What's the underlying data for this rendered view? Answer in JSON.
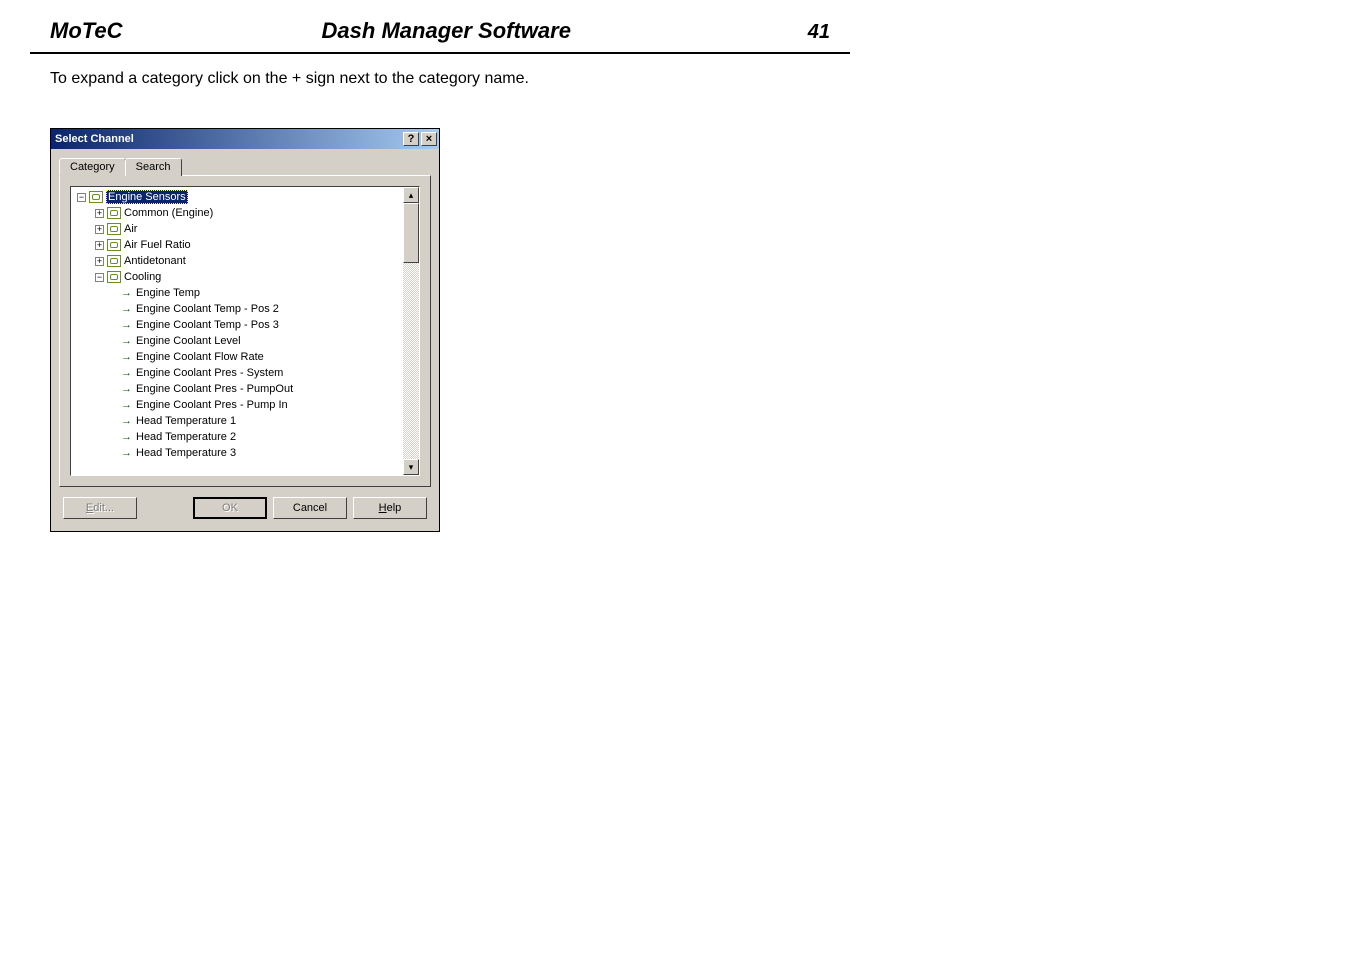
{
  "header": {
    "brand": "MoTeC",
    "title": "Dash Manager Software",
    "page_number": "41"
  },
  "intro_text": "To expand a category click on the + sign next to the category name.",
  "dialog": {
    "title": "Select Channel",
    "help_glyph": "?",
    "close_glyph": "×",
    "tabs": {
      "category_label": "Category",
      "search_label": "Search"
    },
    "tree": {
      "root": "Engine Sensors",
      "folders": [
        {
          "label": "Common (Engine)",
          "expanded": false
        },
        {
          "label": "Air",
          "expanded": false
        },
        {
          "label": "Air Fuel Ratio",
          "expanded": false
        },
        {
          "label": "Antidetonant",
          "expanded": false
        },
        {
          "label": "Cooling",
          "expanded": true
        }
      ],
      "cooling_channels": [
        "Engine Temp",
        "Engine Coolant Temp - Pos 2",
        "Engine Coolant Temp - Pos 3",
        "Engine Coolant Level",
        "Engine Coolant Flow Rate",
        "Engine Coolant Pres - System",
        "Engine Coolant Pres - PumpOut",
        "Engine Coolant Pres - Pump In",
        "Head Temperature 1",
        "Head Temperature 2",
        "Head Temperature 3"
      ]
    },
    "buttons": {
      "edit": "Edit...",
      "ok": "OK",
      "cancel": "Cancel",
      "help_prefix": "H",
      "help_rest": "elp"
    },
    "scroll": {
      "up_glyph": "▴",
      "down_glyph": "▾"
    }
  }
}
